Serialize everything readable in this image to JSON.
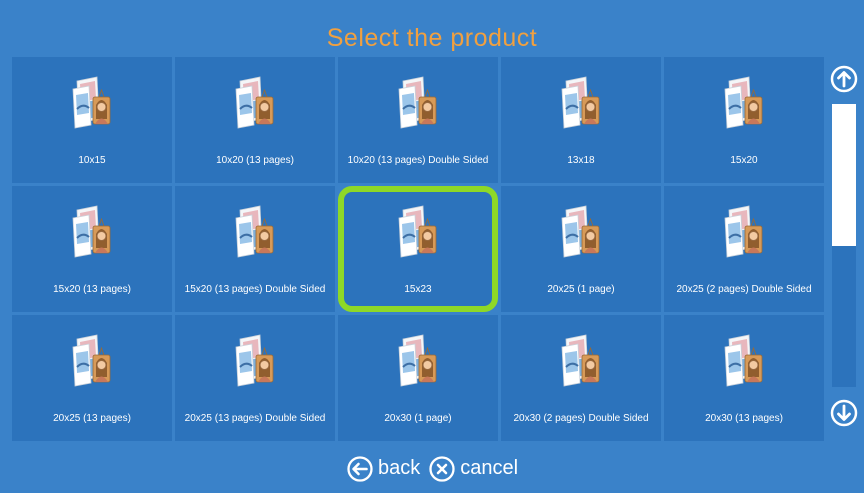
{
  "header": {
    "title": "Select the product"
  },
  "products": [
    {
      "label": "10x15"
    },
    {
      "label": "10x20 (13 pages)"
    },
    {
      "label": "10x20 (13 pages) Double Sided"
    },
    {
      "label": "13x18"
    },
    {
      "label": "15x20"
    },
    {
      "label": "15x20 (13 pages)"
    },
    {
      "label": "15x20 (13 pages) Double Sided"
    },
    {
      "label": "15x23"
    },
    {
      "label": "20x25 (1 page)"
    },
    {
      "label": "20x25 (2 pages) Double Sided"
    },
    {
      "label": "20x25 (13 pages)"
    },
    {
      "label": "20x25 (13 pages) Double Sided"
    },
    {
      "label": "20x30 (1 page)"
    },
    {
      "label": "20x30 (2 pages) Double Sided"
    },
    {
      "label": "20x30 (13 pages)"
    }
  ],
  "selected_index": 7,
  "footer": {
    "back_label": "back",
    "cancel_label": "cancel"
  },
  "icons": {
    "thumbnail": "photo-product-icon",
    "scroll_up": "arrow-up-circle-icon",
    "scroll_down": "arrow-down-circle-icon",
    "back": "arrow-left-circle-icon",
    "cancel": "close-circle-icon"
  },
  "colors": {
    "background": "#3a82c9",
    "tile": "#2c73bc",
    "title": "#f0a040",
    "selection": "#8ed827"
  }
}
